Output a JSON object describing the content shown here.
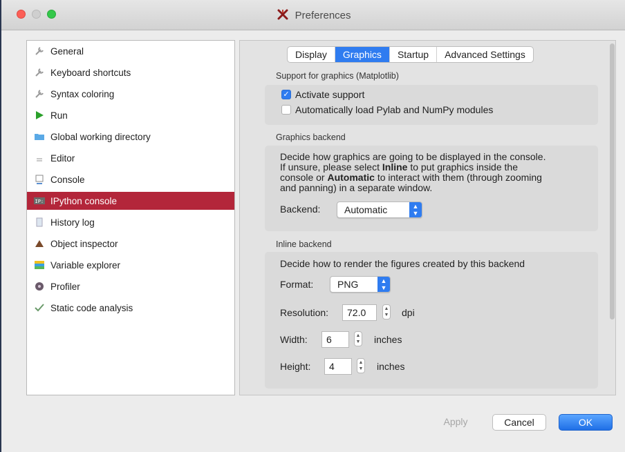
{
  "window": {
    "title": "Preferences",
    "title_icon": "spyder-icon"
  },
  "sidebar": {
    "items": [
      {
        "label": "General",
        "icon": "wrench-icon"
      },
      {
        "label": "Keyboard shortcuts",
        "icon": "keyboard-icon"
      },
      {
        "label": "Syntax coloring",
        "icon": "palette-icon"
      },
      {
        "label": "Run",
        "icon": "play-icon"
      },
      {
        "label": "Global working directory",
        "icon": "folder-icon"
      },
      {
        "label": "Editor",
        "icon": "editor-icon"
      },
      {
        "label": "Console",
        "icon": "console-icon"
      },
      {
        "label": "IPython console",
        "icon": "ipython-icon",
        "selected": true
      },
      {
        "label": "History log",
        "icon": "history-icon"
      },
      {
        "label": "Object inspector",
        "icon": "inspector-icon"
      },
      {
        "label": "Variable explorer",
        "icon": "variables-icon"
      },
      {
        "label": "Profiler",
        "icon": "profiler-icon"
      },
      {
        "label": "Static code analysis",
        "icon": "analysis-icon"
      }
    ]
  },
  "tabs": [
    "Display",
    "Graphics",
    "Startup",
    "Advanced Settings"
  ],
  "active_tab": "Graphics",
  "support": {
    "title": "Support for graphics (Matplotlib)",
    "activate_label": "Activate support",
    "activate_checked": true,
    "pylab_label": "Automatically load Pylab and NumPy modules",
    "pylab_checked": false
  },
  "backend": {
    "title": "Graphics backend",
    "desc_1": "Decide how graphics are going to be displayed in the console.",
    "desc_2a": "If unsure, please select ",
    "desc_2b": "Inline",
    "desc_2c": " to put graphics inside the",
    "desc_3a": "console or ",
    "desc_3b": "Automatic",
    "desc_3c": " to interact with them (through zooming",
    "desc_4": "and panning) in a separate window.",
    "label": "Backend:",
    "value": "Automatic"
  },
  "inline": {
    "title": "Inline backend",
    "desc": "Decide how to render the figures created by this backend",
    "format_label": "Format:",
    "format_value": "PNG",
    "resolution_label": "Resolution:",
    "resolution_value": "72.0",
    "resolution_unit": "dpi",
    "width_label": "Width:",
    "width_value": "6",
    "width_unit": "inches",
    "height_label": "Height:",
    "height_value": "4",
    "height_unit": "inches"
  },
  "buttons": {
    "apply": "Apply",
    "cancel": "Cancel",
    "ok": "OK"
  },
  "colors": {
    "accent": "#2f7cf0",
    "selection": "#b3263a"
  }
}
